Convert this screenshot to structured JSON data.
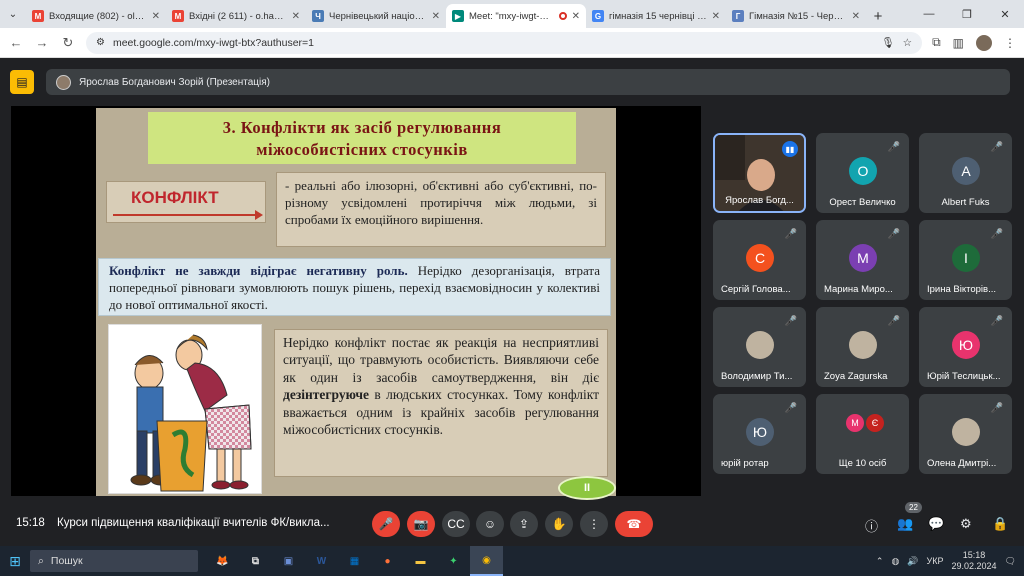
{
  "tabs": [
    {
      "label": "Входящие (802) - olena.hc",
      "icon": "gmail-icon",
      "color": "#ea4335",
      "letter": "M"
    },
    {
      "label": "Вхідні (2 611) - o.hauriak@",
      "icon": "gmail-icon",
      "color": "#ea4335",
      "letter": "M"
    },
    {
      "label": "Чернівецький національ...",
      "icon": "site-icon",
      "color": "#4a7bb5",
      "letter": "Ч"
    },
    {
      "label": "Meet: \"mxy-iwgt-btx\"",
      "icon": "meet-icon",
      "color": "#00897b",
      "letter": "▶"
    },
    {
      "label": "гімназія 15 чернівці - Пош",
      "icon": "google-icon",
      "color": "#4285f4",
      "letter": "G"
    },
    {
      "label": "Гімназія №15 - Чернівецьк",
      "icon": "site-icon",
      "color": "#5b7fbf",
      "letter": "Г"
    }
  ],
  "address": {
    "url": "meet.google.com/mxy-iwgt-btx?authuser=1"
  },
  "presenter": {
    "label": "Ярослав Богданович Зорій (Презентація)"
  },
  "slide": {
    "title_line1": "3. Конфлікти як засіб регулювання",
    "title_line2": "міжособистісних стосунків",
    "keyword": "КОНФЛІКТ",
    "definition": "- реальні або ілюзорні, об'єктивні або суб'єктивні, по-різному усвідомлені протиріччя між людьми, зі спробами їх емоційного вирішення.",
    "note_bold": "Конфлікт не завжди відіграє негативну роль.",
    "note_rest": " Нерідко дезорганізація, втрата попередньої рівноваги зумовлюють пошук рішень, перехід взаємовідносин у колективі до нової оптимальної якості.",
    "text_part1": "Нерідко конфлікт постає як реакція на несприятливі ситуації, що травмують особистість. Виявляючи себе як один із засобів самоутвердження, він діє ",
    "text_bold": "дезінтегруюче",
    "text_part2": " в людських стосунках. Тому конфлікт вважається одним із крайніх засобів регулювання міжособистісних стосунків.",
    "nav_label": "II"
  },
  "participants": [
    {
      "name": "Ярослав Богд...",
      "letter": "",
      "color": "",
      "type": "video"
    },
    {
      "name": "Орест Величко",
      "letter": "О",
      "color": "#12a4af"
    },
    {
      "name": "Albert Fuks",
      "letter": "A",
      "color": "#4e5f72"
    },
    {
      "name": "Сергій Голова...",
      "letter": "С",
      "color": "#f4511e"
    },
    {
      "name": "Марина Миро...",
      "letter": "М",
      "color": "#7b3fb2"
    },
    {
      "name": "Ірина Вікторів...",
      "letter": "І",
      "color": "#1e6b3a"
    },
    {
      "name": "Володимир Ти...",
      "letter": "",
      "color": "",
      "type": "photo"
    },
    {
      "name": "Zoya Zagurska",
      "letter": "",
      "color": "",
      "type": "photo"
    },
    {
      "name": "Юрій Теслицьк...",
      "letter": "Ю",
      "color": "#e8336d"
    },
    {
      "name": "юрій ротар",
      "letter": "Ю",
      "color": "#4e5f72"
    },
    {
      "name": "Ще 10 осіб",
      "letter": "",
      "color": "",
      "type": "more",
      "mini": [
        "М",
        "Є"
      ]
    },
    {
      "name": "Олена Дмитрі...",
      "letter": "",
      "color": "",
      "type": "photo"
    }
  ],
  "controls": {
    "time": "15:18",
    "meeting_title": "Курси підвищення кваліфікації вчителів ФК/викла...",
    "participant_count": "22"
  },
  "taskbar": {
    "search_placeholder": "Пошук",
    "lang": "УКР",
    "time": "15:18",
    "date": "29.02.2024"
  }
}
